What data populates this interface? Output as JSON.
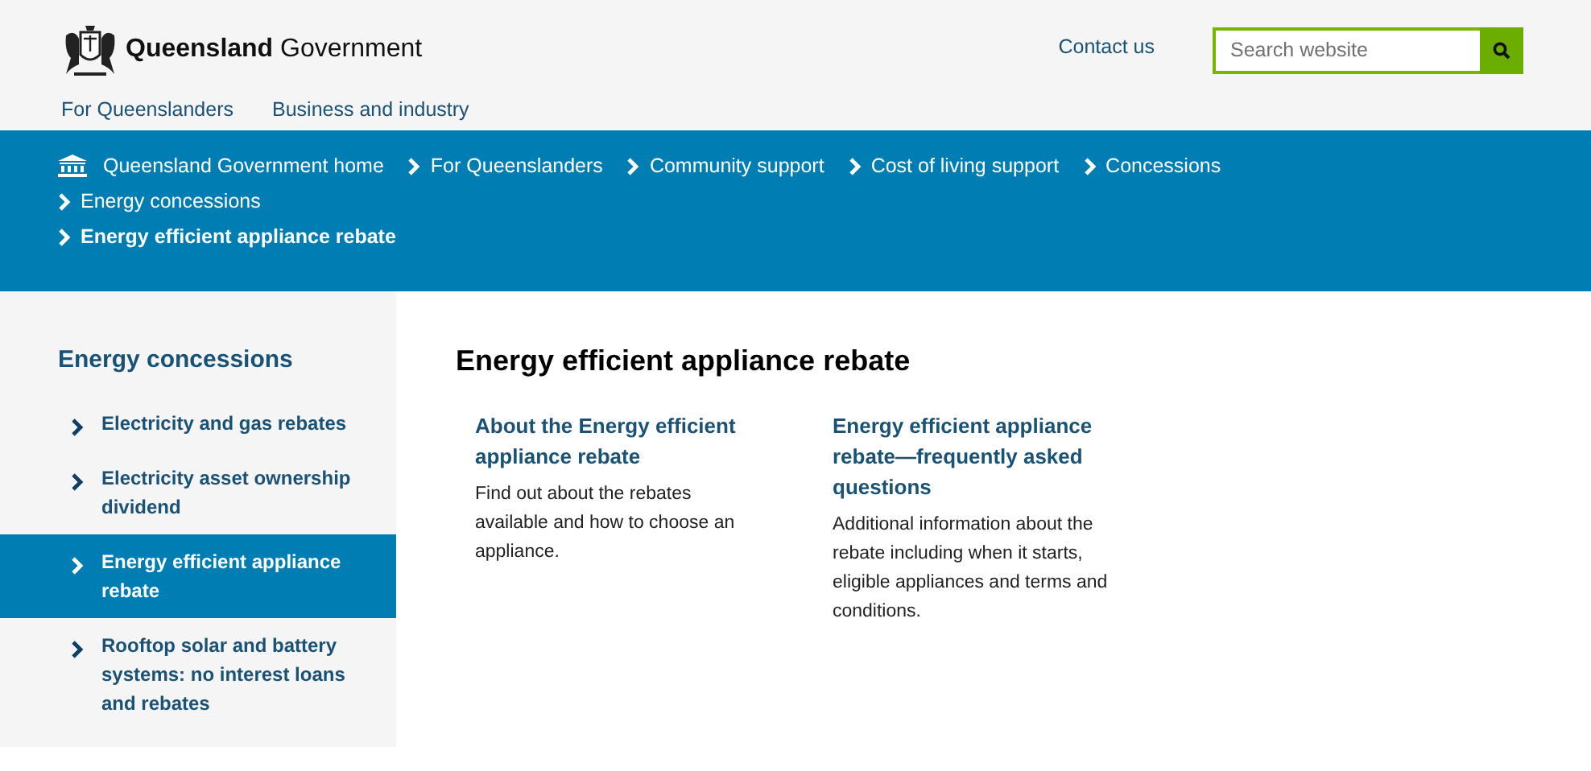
{
  "header": {
    "logo_bold": "Queensland",
    "logo_rest": "Government",
    "contact": "Contact us",
    "search": {
      "placeholder": "Search website"
    },
    "nav": [
      {
        "label": "For Queenslanders"
      },
      {
        "label": "Business and industry"
      }
    ]
  },
  "breadcrumbs": [
    {
      "label": "Queensland Government home",
      "kind": "home"
    },
    {
      "label": "For Queenslanders",
      "kind": "link"
    },
    {
      "label": "Community support",
      "kind": "link"
    },
    {
      "label": "Cost of living support",
      "kind": "link"
    },
    {
      "label": "Concessions",
      "kind": "link"
    },
    {
      "label": "Energy concessions",
      "kind": "link"
    },
    {
      "label": "Energy efficient appliance rebate",
      "kind": "current"
    }
  ],
  "sidebar": {
    "title": "Energy concessions",
    "items": [
      {
        "label": "Electricity and gas rebates",
        "selected": false
      },
      {
        "label": "Electricity asset ownership dividend",
        "selected": false
      },
      {
        "label": "Energy efficient appliance rebate",
        "selected": true
      },
      {
        "label": "Rooftop solar and battery systems: no interest loans and rebates",
        "selected": false
      }
    ]
  },
  "main": {
    "title": "Energy efficient appliance rebate",
    "cards": [
      {
        "title": "About the Energy efficient appliance rebate",
        "text": "Find out about the rebates available and how to choose an appliance."
      },
      {
        "title": "Energy efficient appliance rebate—frequently asked questions",
        "text": "Additional information about the rebate including when it starts, eligible appliances and terms and conditions."
      }
    ]
  }
}
